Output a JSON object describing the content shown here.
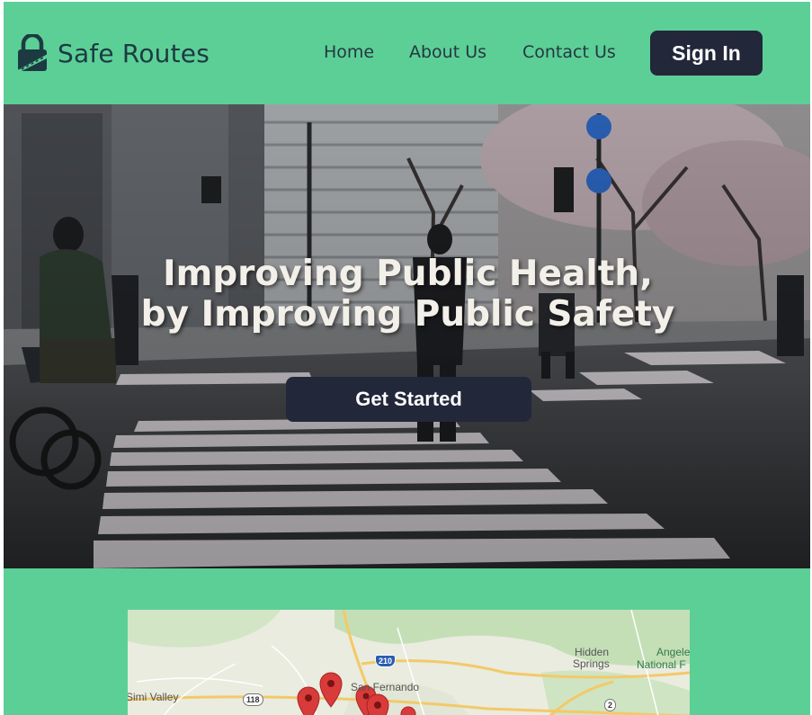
{
  "brand": {
    "name": "Safe Routes",
    "icon": "lock-road-icon"
  },
  "nav": {
    "links": [
      {
        "label": "Home"
      },
      {
        "label": "About Us"
      },
      {
        "label": "Contact Us"
      }
    ],
    "sign_in_label": "Sign In"
  },
  "hero": {
    "title_line1": "Improving Public Health,",
    "title_line2": "by Improving Public Safety",
    "cta_label": "Get Started"
  },
  "map": {
    "labels": {
      "simi_valley": "Simi Valley",
      "san_fernando": "San Fernando",
      "hidden_springs_1": "Hidden",
      "hidden_springs_2": "Springs",
      "angeles_1": "Angele",
      "angeles_2": "National F"
    },
    "shields": {
      "i210": "210",
      "r118": "118",
      "r2": "2"
    }
  },
  "colors": {
    "accent": "#5ccf97",
    "button": "#22273a",
    "brand_text": "#1d3a42",
    "marker": "#d93b3b"
  }
}
